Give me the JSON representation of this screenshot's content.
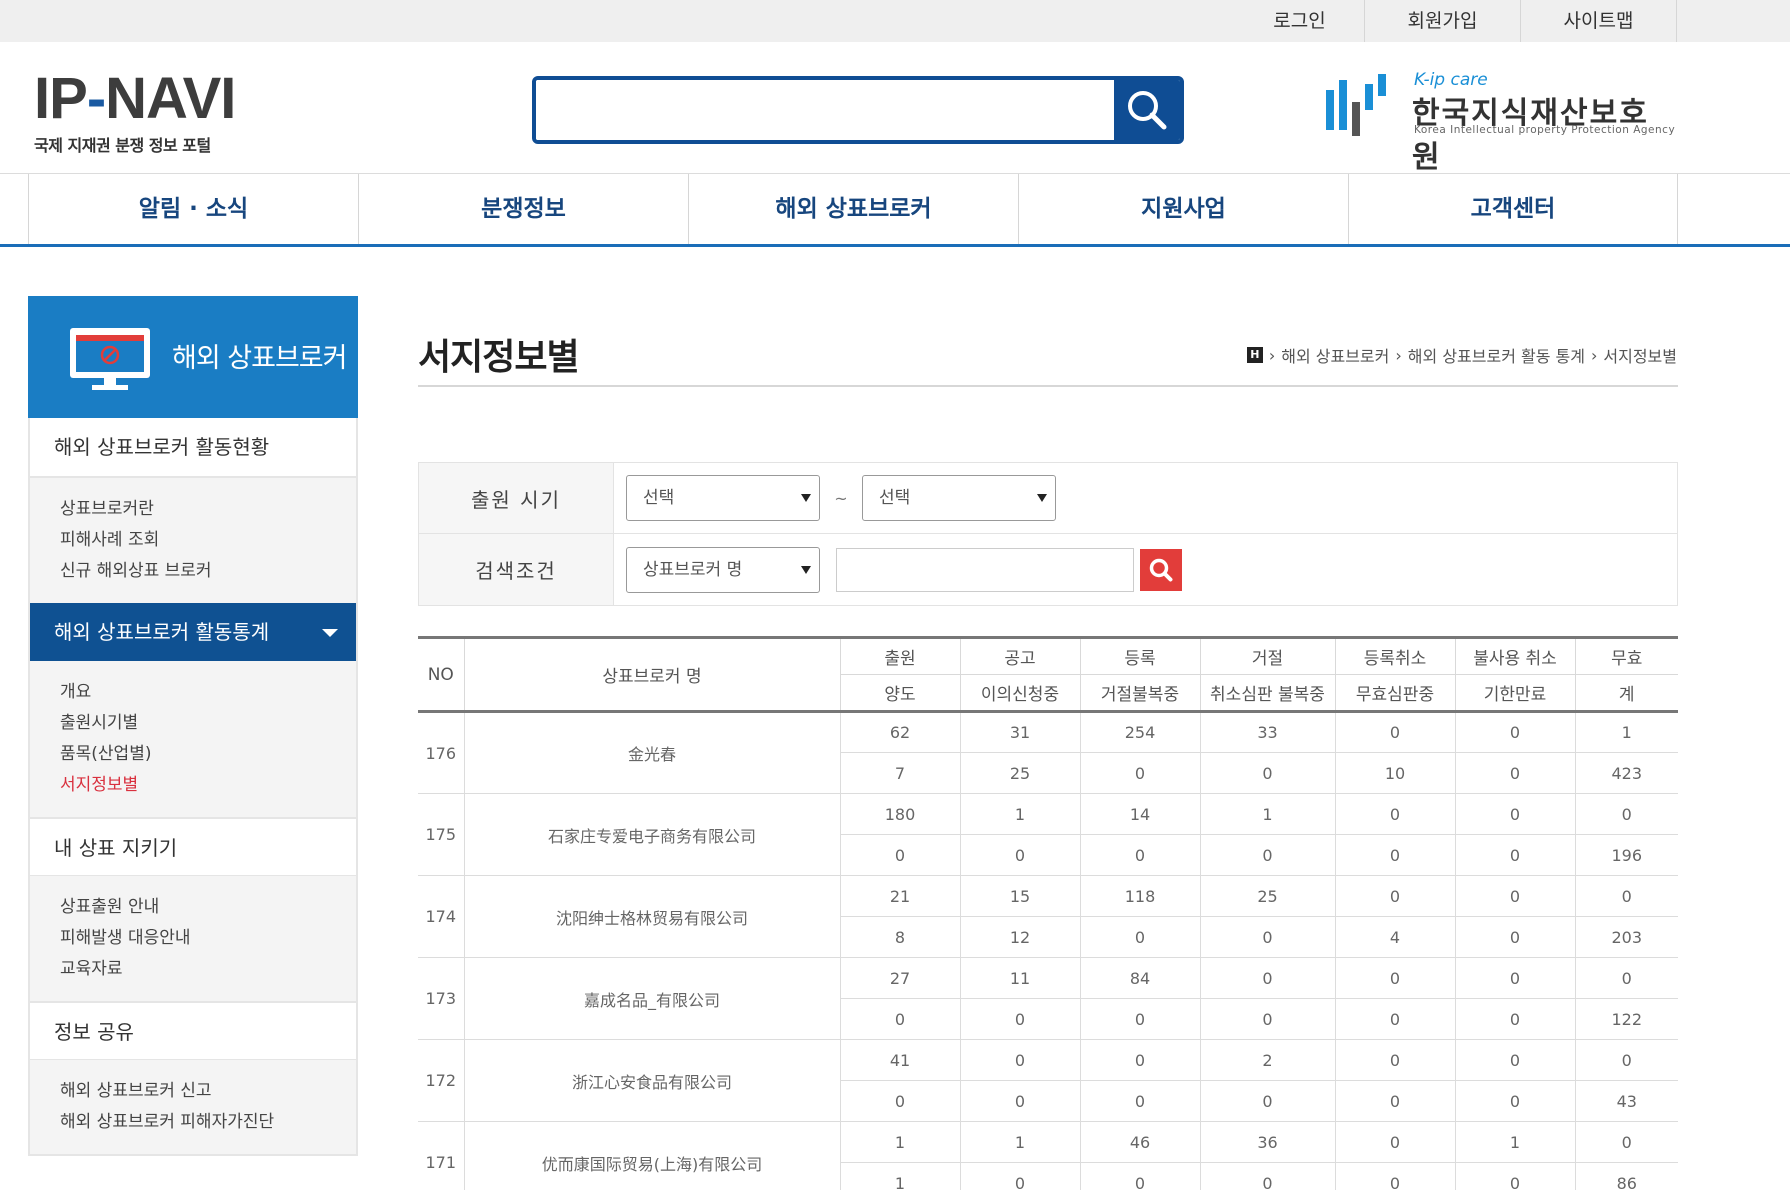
{
  "util": {
    "login": "로그인",
    "join": "회원가입",
    "sitemap": "사이트맵"
  },
  "logo": {
    "mark_a": "IP",
    "mark_b": "NAVI",
    "sub": "국제 지재권 분쟁 정보 포털"
  },
  "agency": {
    "kip": "K-ip care",
    "name": "한국지식재산보호원",
    "eng": "Korea Intellectual property Protection Agency"
  },
  "search": {
    "placeholder": ""
  },
  "gnb": [
    "알림 · 소식",
    "분쟁정보",
    "해외 상표브로커",
    "지원사업",
    "고객센터"
  ],
  "side": {
    "title": "해외 상표브로커",
    "group1": {
      "title": "해외 상표브로커 활동현황",
      "items": [
        "상표브로커란",
        "피해사례 조회",
        "신규 해외상표 브로커"
      ]
    },
    "group2": {
      "title": "해외 상표브로커 활동통계",
      "items": [
        "개요",
        "출원시기별",
        "품목(산업별)",
        "서지정보별"
      ]
    },
    "group3": {
      "title": "내 상표 지키기",
      "items": [
        "상표출원 안내",
        "피해발생 대응안내",
        "교육자료"
      ]
    },
    "group4": {
      "title": "정보 공유",
      "items": [
        "해외 상표브로커 신고",
        "해외 상표브로커 피해자가진단"
      ]
    }
  },
  "page": {
    "title": "서지정보별",
    "breadcrumb": [
      "해외 상표브로커",
      "해외 상표브로커 활동 통계",
      "서지정보별"
    ],
    "home_badge": "H"
  },
  "filter": {
    "period_label": "출원 시기",
    "period_from": "선택",
    "tilde": "~",
    "period_to": "선택",
    "cond_label": "검색조건",
    "cond_select": "상표브로커 명",
    "cond_input": ""
  },
  "table": {
    "h_no": "NO",
    "h_name": "상표브로커 명",
    "h_row1": [
      "출원",
      "공고",
      "등록",
      "거절",
      "등록취소",
      "불사용 취소",
      "무효"
    ],
    "h_row2": [
      "양도",
      "이의신청중",
      "거절불복중",
      "취소심판 불복중",
      "무효심판중",
      "기한만료",
      "계"
    ],
    "rows": [
      {
        "no": "176",
        "name": "金光春",
        "a": [
          "62",
          "31",
          "254",
          "33",
          "0",
          "0",
          "1"
        ],
        "b": [
          "7",
          "25",
          "0",
          "0",
          "10",
          "0",
          "423"
        ]
      },
      {
        "no": "175",
        "name": "石家庄专爱电子商务有限公司",
        "a": [
          "180",
          "1",
          "14",
          "1",
          "0",
          "0",
          "0"
        ],
        "b": [
          "0",
          "0",
          "0",
          "0",
          "0",
          "0",
          "196"
        ]
      },
      {
        "no": "174",
        "name": "沈阳绅士格林贸易有限公司",
        "a": [
          "21",
          "15",
          "118",
          "25",
          "0",
          "0",
          "0"
        ],
        "b": [
          "8",
          "12",
          "0",
          "0",
          "4",
          "0",
          "203"
        ]
      },
      {
        "no": "173",
        "name": "嘉成名品_有限公司",
        "a": [
          "27",
          "11",
          "84",
          "0",
          "0",
          "0",
          "0"
        ],
        "b": [
          "0",
          "0",
          "0",
          "0",
          "0",
          "0",
          "122"
        ]
      },
      {
        "no": "172",
        "name": "浙江心安食品有限公司",
        "a": [
          "41",
          "0",
          "0",
          "2",
          "0",
          "0",
          "0"
        ],
        "b": [
          "0",
          "0",
          "0",
          "0",
          "0",
          "0",
          "43"
        ]
      },
      {
        "no": "171",
        "name": "优而康国际贸易(上海)有限公司",
        "a": [
          "1",
          "1",
          "46",
          "36",
          "0",
          "1",
          "0"
        ],
        "b": [
          "1",
          "0",
          "0",
          "0",
          "0",
          "0",
          "86"
        ]
      }
    ]
  }
}
